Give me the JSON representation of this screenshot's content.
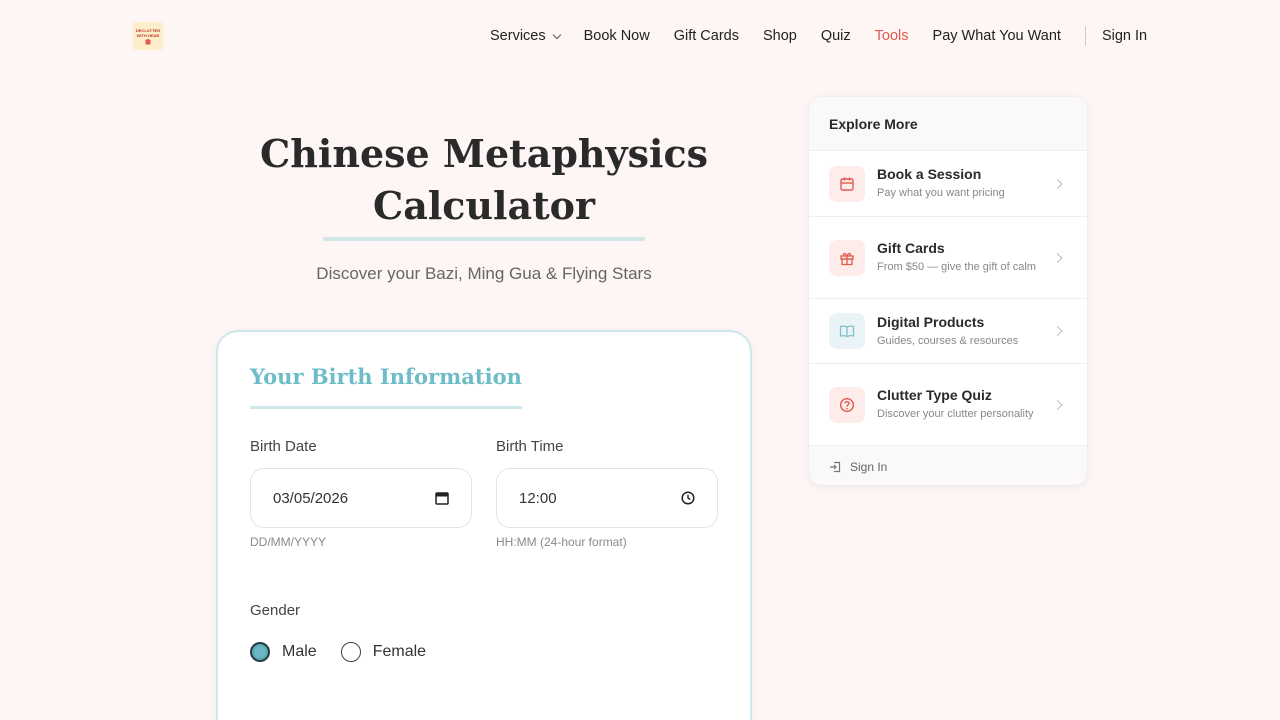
{
  "header": {
    "logo_text": "DECLUTTER WITH HEAR",
    "nav": [
      {
        "label": "Services",
        "has_dropdown": true
      },
      {
        "label": "Book Now"
      },
      {
        "label": "Gift Cards"
      },
      {
        "label": "Shop"
      },
      {
        "label": "Quiz"
      },
      {
        "label": "Tools",
        "active": true
      },
      {
        "label": "Pay What You Want"
      }
    ],
    "sign_in": "Sign In"
  },
  "hero": {
    "title_line1": "Chinese Metaphysics",
    "title_line2": "Calculator",
    "subtitle": "Discover your Bazi, Ming Gua & Flying Stars"
  },
  "form": {
    "title": "Your Birth Information",
    "birth_date": {
      "label": "Birth Date",
      "value": "03/05/2026",
      "hint": "DD/MM/YYYY"
    },
    "birth_time": {
      "label": "Birth Time",
      "value": "12:00",
      "hint": "HH:MM (24-hour format)"
    },
    "gender": {
      "label": "Gender",
      "options": [
        "Male",
        "Female"
      ],
      "selected": "Male"
    }
  },
  "sidebar": {
    "title": "Explore More",
    "items": [
      {
        "title": "Book a Session",
        "sub": "Pay what you want pricing",
        "icon": "calendar-icon"
      },
      {
        "title": "Gift Cards",
        "sub": "From $50 — give the gift of calm",
        "icon": "gift-icon"
      },
      {
        "title": "Digital Products",
        "sub": "Guides, courses & resources",
        "icon": "book-icon"
      },
      {
        "title": "Clutter Type Quiz",
        "sub": "Discover your clutter personality",
        "icon": "question-icon"
      }
    ],
    "sign_in": "Sign In"
  },
  "colors": {
    "accent": "#e05a4f",
    "teal": "#6dbcc7",
    "background": "#fdf6f5"
  }
}
